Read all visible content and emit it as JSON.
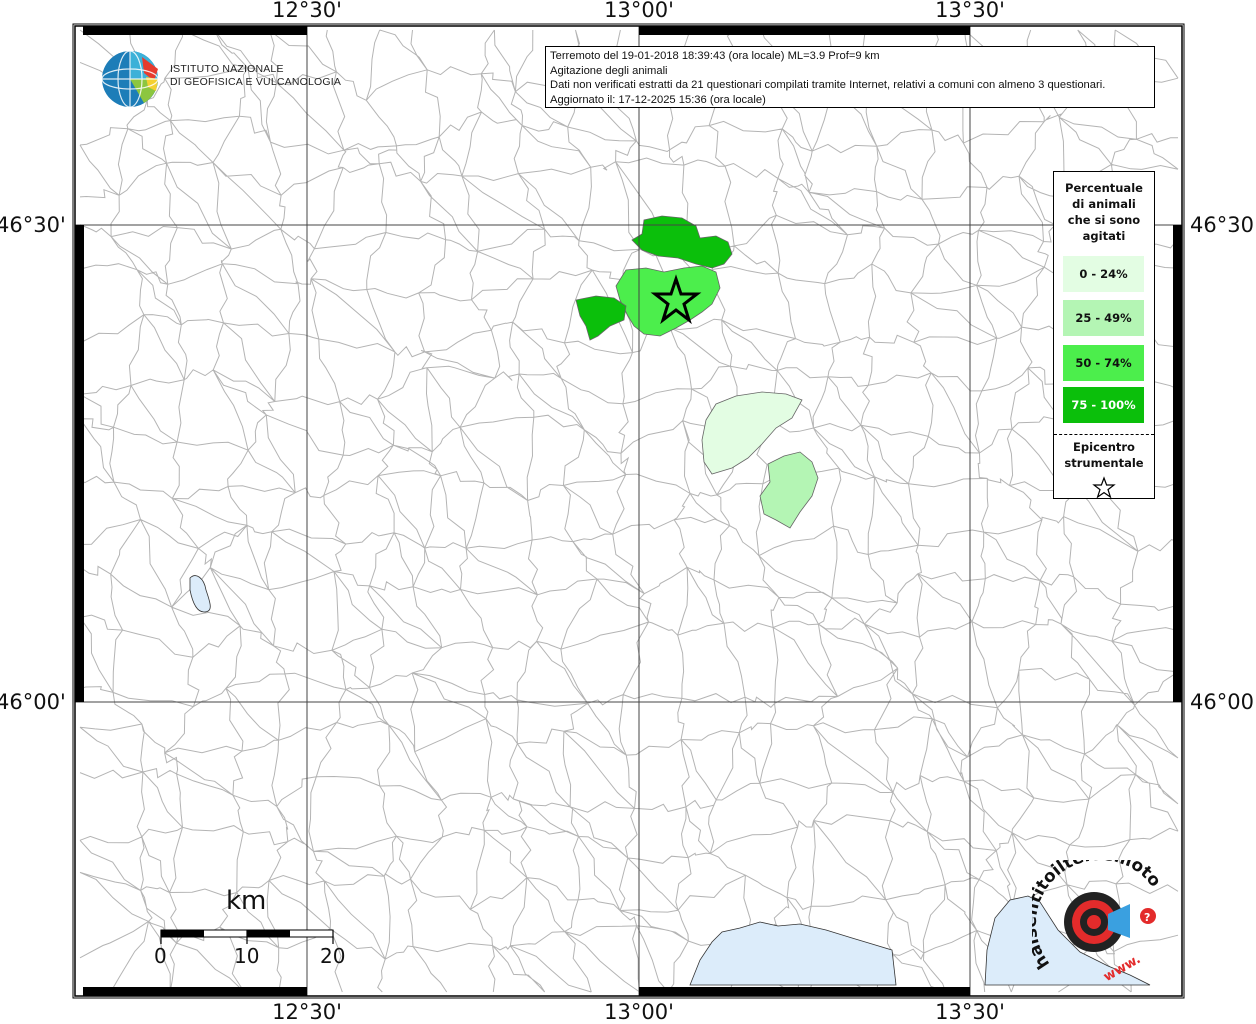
{
  "map": {
    "axis_labels": {
      "top": [
        "12°30'",
        "13°00'",
        "13°30'"
      ],
      "bottom": [
        "12°30'",
        "13°00'",
        "13°30'"
      ],
      "left": [
        "46°30'",
        "46°00'"
      ],
      "right": [
        "46°30'",
        "46°00'"
      ]
    }
  },
  "info_box": {
    "line1": "Terremoto del 19-01-2018 18:39:43 (ora locale) ML=3.9 Prof=9 km",
    "line2": "Agitazione degli animali",
    "line3": "Dati non verificati estratti da 21 questionari compilati tramite Internet, relativi a comuni con almeno 3 questionari.",
    "line4": "Aggiornato il: 17-12-2025 15:36 (ora locale)"
  },
  "logo_ingv": {
    "line1": "ISTITUTO NAZIONALE",
    "line2": "DI GEOFISICA E VULCANOLOGIA"
  },
  "legend": {
    "title_lines": [
      "Percentuale",
      "di animali",
      "che si sono",
      "agitati"
    ],
    "items": [
      {
        "label": "0 - 24%",
        "color": "#e3fde3",
        "text_color": "#111111"
      },
      {
        "label": "25 - 49%",
        "color": "#b4f5b4",
        "text_color": "#111111"
      },
      {
        "label": "50 - 74%",
        "color": "#4cee4c",
        "text_color": "#111111"
      },
      {
        "label": "75 - 100%",
        "color": "#0bbf0b",
        "text_color": "#ffffff"
      }
    ],
    "epicenter_lines": [
      "Epicentro",
      "strumentale"
    ]
  },
  "scale_bar": {
    "unit": "km",
    "labels": [
      "0",
      "10",
      "20"
    ]
  },
  "logo_hsv": {
    "text": "haisentitoilterremoto.it",
    "url_text": "www."
  },
  "colors": {
    "boundary": "#b0b0b0",
    "grid": "#444444",
    "water": "#dcecfa",
    "frame": "#000000"
  }
}
